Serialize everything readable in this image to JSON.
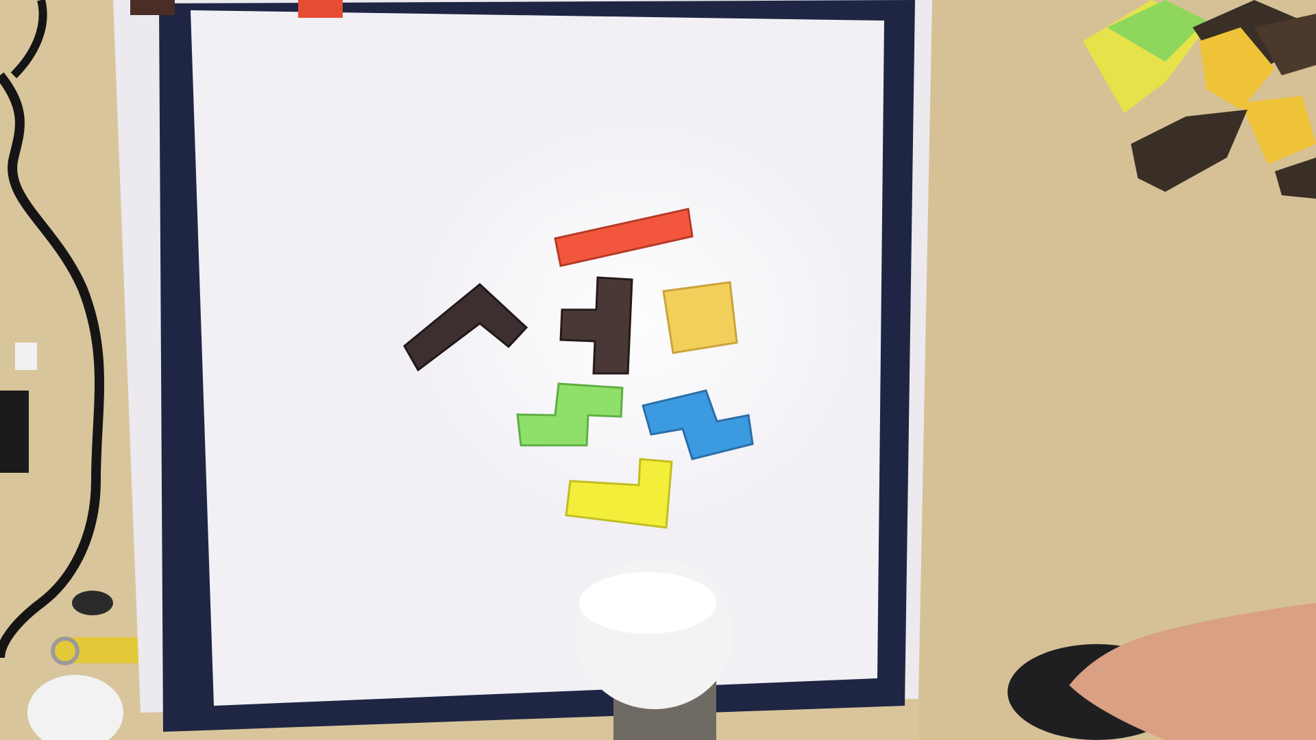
{
  "scene": {
    "description_free": true,
    "colors": {
      "table": "#d9c59c",
      "table_shadow": "#c3ac7e",
      "paper_outer": "#eceaee",
      "tape": "#1e2643",
      "paper_inner": "#f2f0f5",
      "lamp": "#f3f3f3",
      "lamp_base": "#6f6a63",
      "hand": "#d9a083",
      "mouse": "#1f1f21",
      "cable": "#151515",
      "lighter": "#e3c83a"
    }
  },
  "pieces": [
    {
      "name": "red-i-piece",
      "color": "#f2573e",
      "edge": "#b63a26"
    },
    {
      "name": "brown-v-piece",
      "color": "#3d2f30",
      "edge": "#1f1718"
    },
    {
      "name": "brown-t-piece",
      "color": "#4a3836",
      "edge": "#241a19"
    },
    {
      "name": "yellow-square-piece",
      "color": "#f2cf5a",
      "edge": "#c9a43a"
    },
    {
      "name": "green-s-piece",
      "color": "#8fe06a",
      "edge": "#5fae43"
    },
    {
      "name": "blue-z-piece",
      "color": "#3c9ae0",
      "edge": "#2a6fa8"
    },
    {
      "name": "yellow-l-piece",
      "color": "#f2ee3a",
      "edge": "#c3bd1f"
    }
  ],
  "side_pile": [
    {
      "name": "pile-green-block",
      "color": "#8fd65c"
    },
    {
      "name": "pile-yellow-block",
      "color": "#e6e24a"
    },
    {
      "name": "pile-dark-block",
      "color": "#3a2f26"
    },
    {
      "name": "pile-orange-block",
      "color": "#efc338"
    },
    {
      "name": "pile-brown-block",
      "color": "#4b3a2c"
    }
  ]
}
